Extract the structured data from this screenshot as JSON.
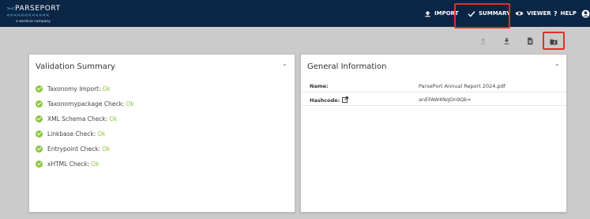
{
  "brand": {
    "name": "PARSEPORT",
    "chevrons_top": "><",
    "chevrons_row": "<<<<<<<<<<<<",
    "tagline": "a workiva company"
  },
  "nav": {
    "import_label": "IMPORT",
    "summary_label": "SUMMARY",
    "viewer_label": "VIEWER",
    "help_label": "HELP"
  },
  "toolbar": {
    "icons": [
      "upload-icon",
      "download-icon",
      "document-icon",
      "folder-icon"
    ]
  },
  "validation": {
    "title": "Validation Summary",
    "items": [
      {
        "label": "Taxonomy Import:",
        "status": "Ok"
      },
      {
        "label": "Taxonomypackage Check:",
        "status": "Ok"
      },
      {
        "label": "XML Schema Check:",
        "status": "Ok"
      },
      {
        "label": "Linkbase Check:",
        "status": "Ok"
      },
      {
        "label": "Entrypoint Check:",
        "status": "Ok"
      },
      {
        "label": "xHTML Check:",
        "status": "Ok"
      }
    ]
  },
  "general": {
    "title": "General Information",
    "name_label": "Name:",
    "name_value": "ParsePort Annual Report 2024.pdf",
    "hash_label": "Hashcode:",
    "hash_value": "anEFAW4NqOn9Qk="
  },
  "colors": {
    "topbar": "#0b2545",
    "ok_green": "#8dc63f",
    "highlight": "#e1302a",
    "background": "#cbcbcb"
  }
}
